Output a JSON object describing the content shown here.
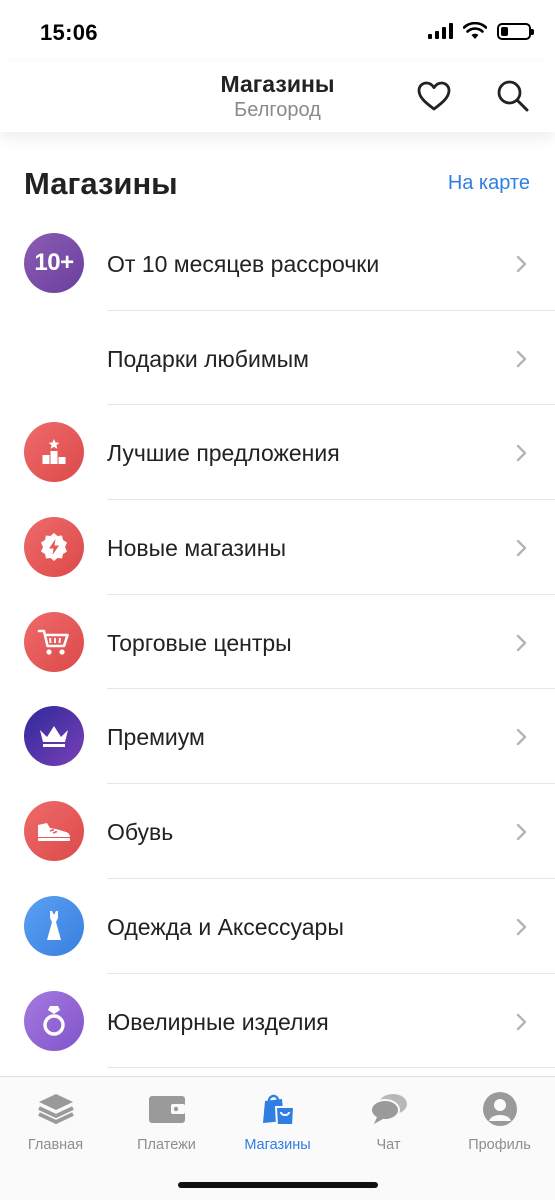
{
  "status_bar": {
    "time": "15:06",
    "icons": [
      "cellular-signal-icon",
      "wifi-icon",
      "battery-icon"
    ],
    "battery_level": 0.25
  },
  "header": {
    "title": "Магазины",
    "subtitle": "Белгород",
    "actions": [
      "heart-icon",
      "search-icon"
    ]
  },
  "section": {
    "title": "Магазины",
    "map_link": "На карте"
  },
  "categories": [
    {
      "label": "От 10 месяцев рассрочки",
      "icon": "installment-10-plus-icon",
      "icon_text": "10+",
      "color": "#7a4fae"
    },
    {
      "label": "Подарки любимым",
      "icon": "",
      "color": ""
    },
    {
      "label": "Лучшие предложения",
      "icon": "podium-star-icon",
      "color": "#e55a5a"
    },
    {
      "label": "Новые магазины",
      "icon": "lightning-badge-icon",
      "color": "#e55a5a"
    },
    {
      "label": "Торговые центры",
      "icon": "shopping-cart-icon",
      "color": "#e55a5a"
    },
    {
      "label": "Премиум",
      "icon": "crown-icon",
      "color": "#3b2fa3"
    },
    {
      "label": "Обувь",
      "icon": "sneaker-icon",
      "color": "#e55a5a"
    },
    {
      "label": "Одежда и Аксессуары",
      "icon": "dress-icon",
      "color": "#4a8ee8"
    },
    {
      "label": "Ювелирные изделия",
      "icon": "ring-icon",
      "color": "#9166d4"
    }
  ],
  "tab_bar": {
    "active": "Магазины",
    "active_color": "#2f7ee3",
    "tabs": [
      {
        "label": "Главная",
        "icon": "layers-icon"
      },
      {
        "label": "Платежи",
        "icon": "wallet-icon"
      },
      {
        "label": "Магазины",
        "icon": "shopping-bags-icon"
      },
      {
        "label": "Чат",
        "icon": "chat-bubbles-icon"
      },
      {
        "label": "Профиль",
        "icon": "profile-icon"
      }
    ]
  }
}
